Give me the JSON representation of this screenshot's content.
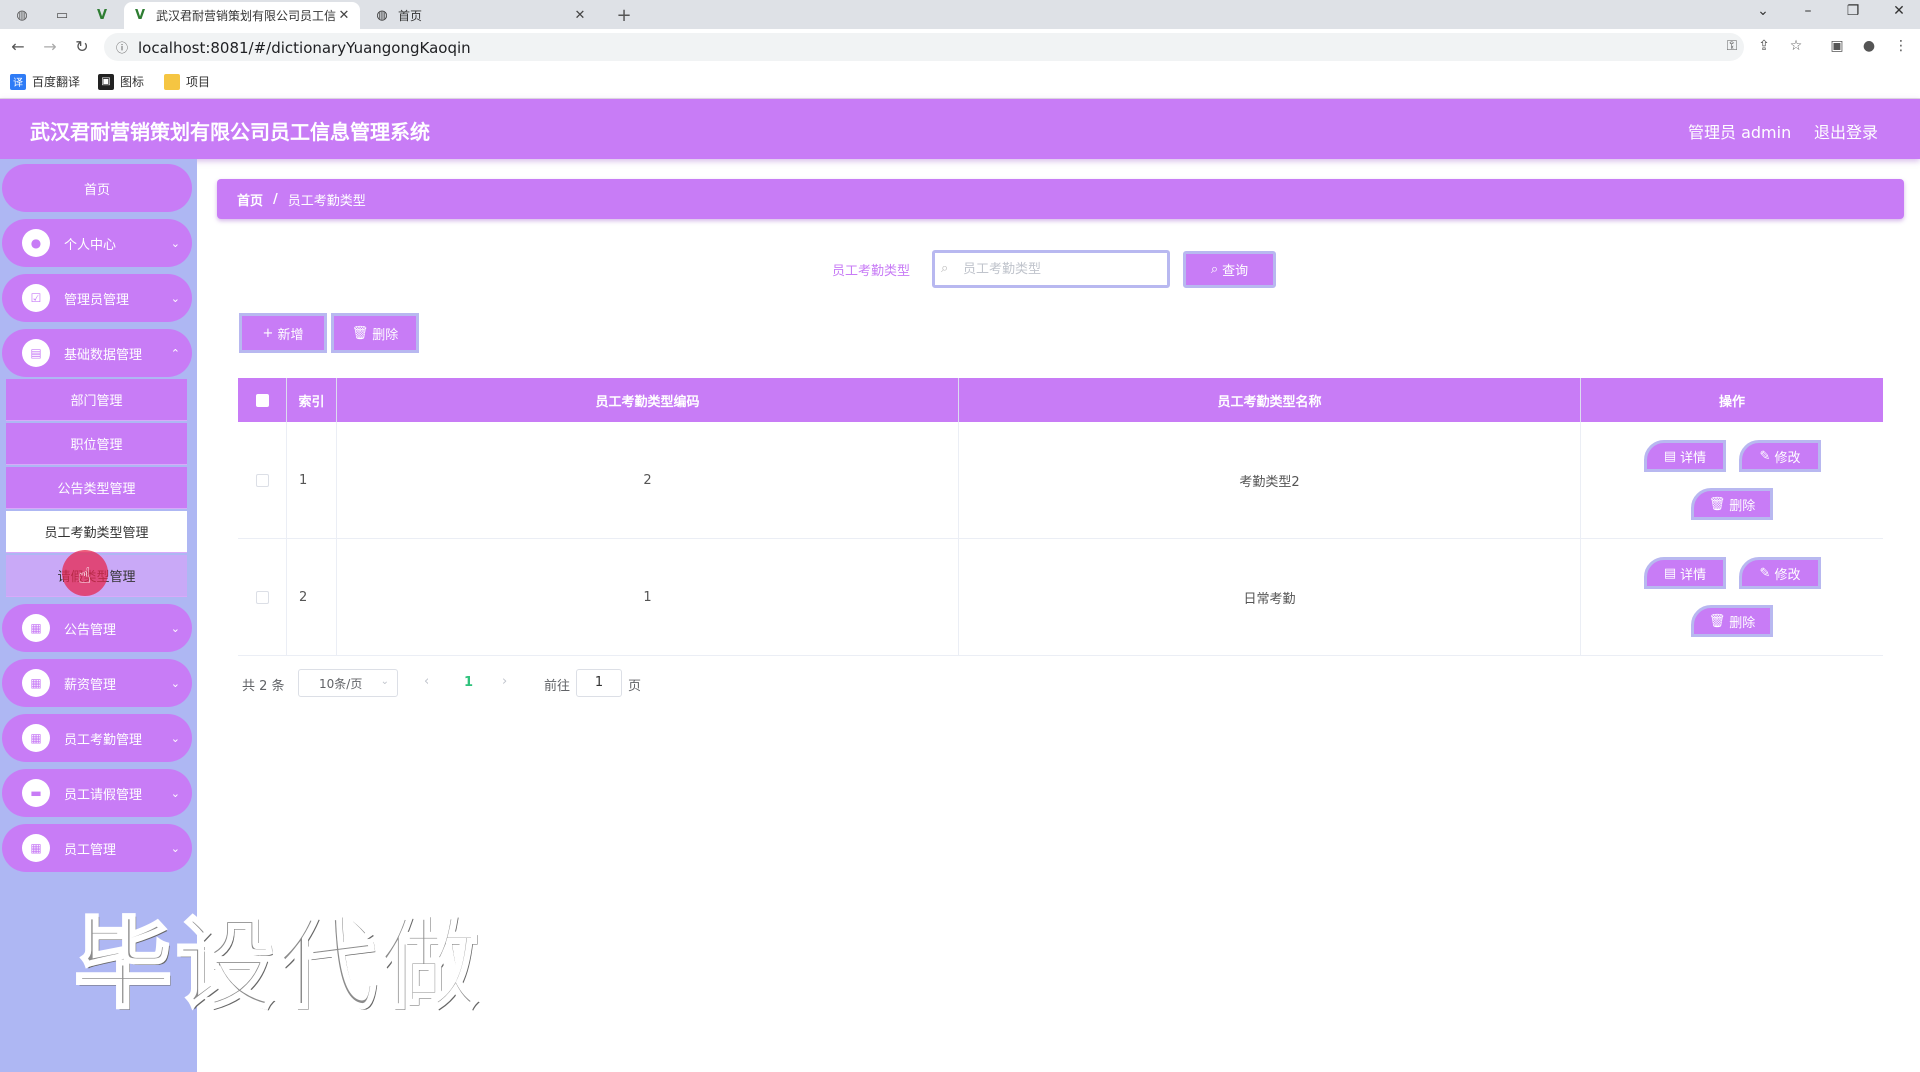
{
  "browser": {
    "tabs": [
      {
        "title": "武汉君耐营销策划有限公司员工信",
        "active": true
      },
      {
        "title": "首页",
        "active": false
      }
    ],
    "url": "localhost:8081/#/dictionaryYuangongKaoqin",
    "bookmarks": [
      "百度翻译",
      "图标",
      "项目"
    ]
  },
  "header": {
    "title": "武汉君耐营销策划有限公司员工信息管理系统",
    "admin": "管理员 admin",
    "logout": "退出登录"
  },
  "sidebar": {
    "home": "首页",
    "menus": [
      {
        "label": "个人中心",
        "icon": "user-icon"
      },
      {
        "label": "管理员管理",
        "icon": "check-square-icon"
      },
      {
        "label": "基础数据管理",
        "icon": "clipboard-icon"
      },
      {
        "label": "公告管理",
        "icon": "grid-icon"
      },
      {
        "label": "薪资管理",
        "icon": "grid-icon"
      },
      {
        "label": "员工考勤管理",
        "icon": "grid-icon"
      },
      {
        "label": "员工请假管理",
        "icon": "chat-icon"
      },
      {
        "label": "员工管理",
        "icon": "grid-icon"
      }
    ],
    "submenu": [
      "部门管理",
      "职位管理",
      "公告类型管理",
      "员工考勤类型管理",
      "请假类型管理"
    ]
  },
  "watermark": "毕设代做",
  "breadcrumb": {
    "home": "首页",
    "sep": "/",
    "current": "员工考勤类型"
  },
  "search": {
    "label": "员工考勤类型",
    "placeholder": "员工考勤类型",
    "value": "",
    "button": "查询"
  },
  "actions": {
    "add": "新增",
    "delete": "删除"
  },
  "table": {
    "columns": [
      "索引",
      "员工考勤类型编码",
      "员工考勤类型名称",
      "操作"
    ],
    "rows": [
      {
        "index": "1",
        "code": "2",
        "name": "考勤类型2"
      },
      {
        "index": "2",
        "code": "1",
        "name": "日常考勤"
      }
    ],
    "ops": {
      "detail": "详情",
      "edit": "修改",
      "delete": "删除"
    }
  },
  "pagination": {
    "total": "共 2 条",
    "page_size": "10条/页",
    "current": "1",
    "goto": "前往",
    "goto_value": "1",
    "unit": "页"
  },
  "colors": {
    "accent": "#c87cf6",
    "sidebar_bg": "#aeb7f3",
    "border": "#b8b8f0"
  }
}
